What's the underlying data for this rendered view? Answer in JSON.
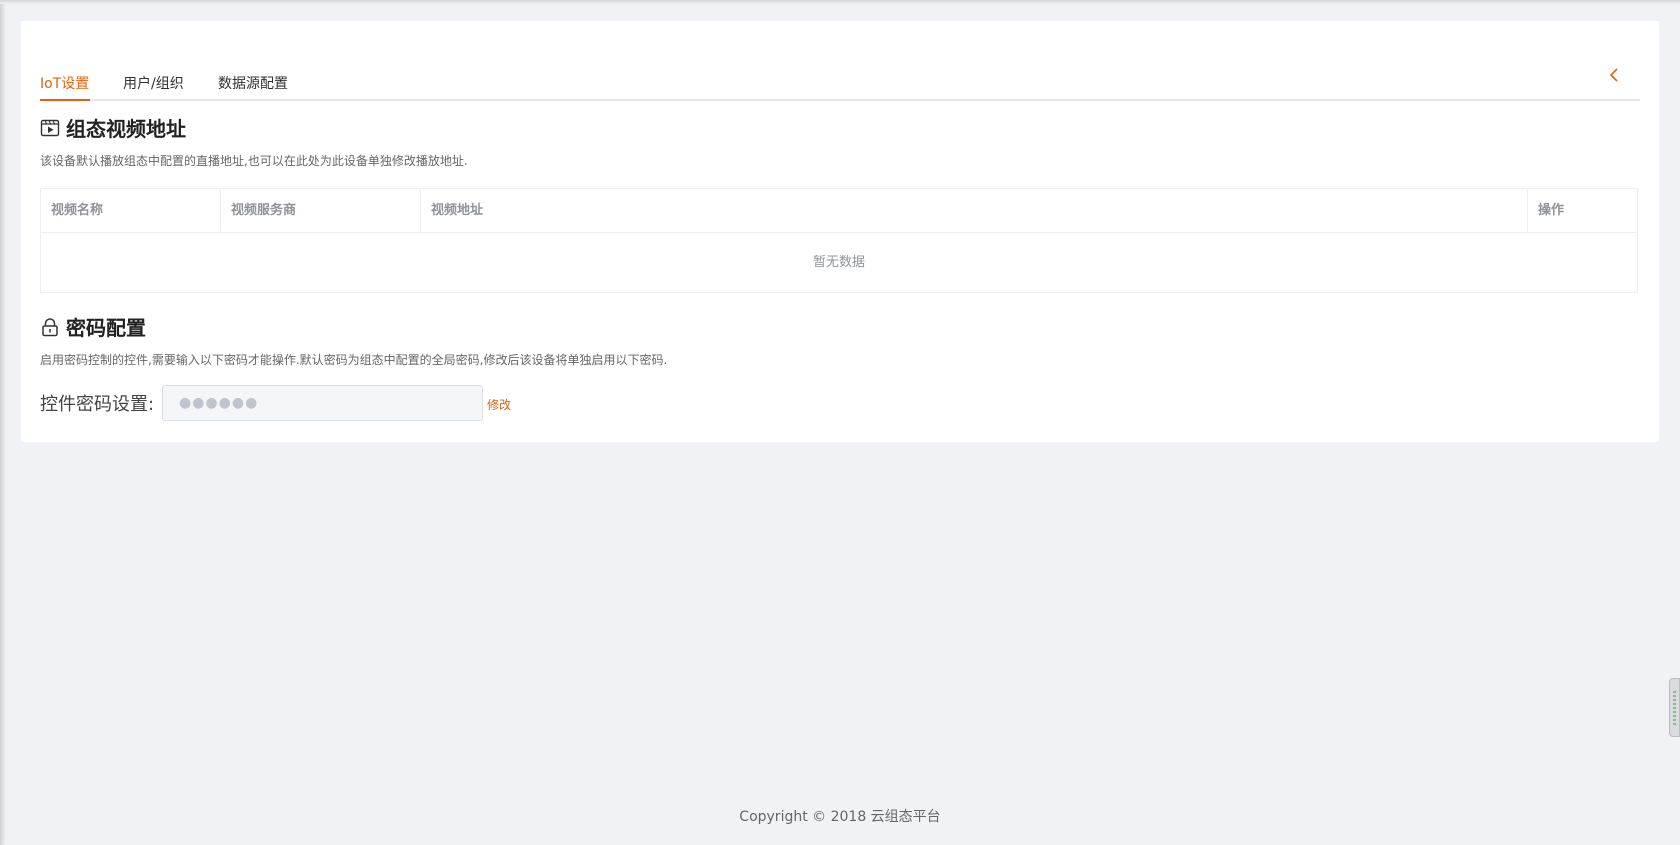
{
  "tabs": [
    {
      "label": "IoT设置",
      "active": true
    },
    {
      "label": "用户/组织",
      "active": false
    },
    {
      "label": "数据源配置",
      "active": false
    }
  ],
  "video_section": {
    "title": "组态视频地址",
    "description": "该设备默认播放组态中配置的直播地址,也可以在此处为此设备单独修改播放地址.",
    "columns": [
      "视频名称",
      "视频服务商",
      "视频地址",
      "操作"
    ],
    "rows": [],
    "empty_text": "暂无数据"
  },
  "password_section": {
    "title": "密码配置",
    "description": "启用密码控制的控件,需要输入以下密码才能操作.默认密码为组态中配置的全局密码,修改后该设备将单独启用以下密码.",
    "field_label": "控件密码设置:",
    "field_placeholder": "●●●●●●",
    "edit_label": "修改"
  },
  "footer": {
    "copyright": "Copyright © 2018 云组态平台"
  },
  "colors": {
    "accent": "#e4610f",
    "background": "#f0f2f5",
    "card": "#ffffff"
  },
  "icons": {
    "collapse": "chevron-left-icon",
    "video": "video-play-icon",
    "password": "lock-icon"
  }
}
